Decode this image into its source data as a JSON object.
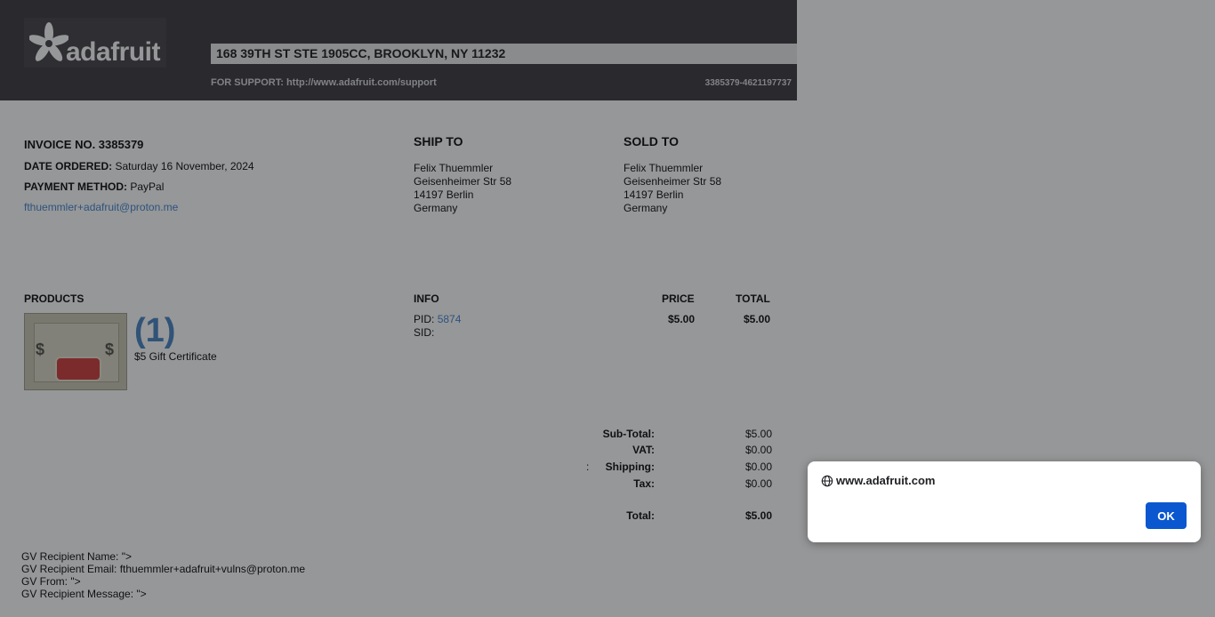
{
  "header": {
    "logo_text": "adafruit",
    "address": "168 39TH ST STE 1905CC, BROOKLYN, NY 11232",
    "support": "FOR SUPPORT: http://www.adafruit.com/support",
    "order_ref": "3385379-4621197737"
  },
  "invoice": {
    "title": "INVOICE NO. 3385379",
    "date_label": "DATE ORDERED:",
    "date_value": "Saturday 16 November, 2024",
    "payment_label": "PAYMENT METHOD:",
    "payment_value": "PayPal",
    "email": "fthuemmler+adafruit@proton.me"
  },
  "ship_to": {
    "title": "SHIP TO",
    "lines": [
      "Felix Thuemmler",
      "Geisenheimer Str 58",
      "14197 Berlin",
      "Germany"
    ]
  },
  "sold_to": {
    "title": "SOLD TO",
    "lines": [
      "Felix Thuemmler",
      "Geisenheimer Str 58",
      "14197 Berlin",
      "Germany"
    ]
  },
  "products": {
    "col_products": "PRODUCTS",
    "col_info": "INFO",
    "col_price": "PRICE",
    "col_total": "TOTAL",
    "items": [
      {
        "qty": "(1)",
        "name": "$5 Gift Certificate",
        "pid_label": "PID:",
        "pid_value": "5874",
        "sid_label": "SID:",
        "price": "$5.00",
        "total": "$5.00"
      }
    ]
  },
  "totals": {
    "subtotal_label": "Sub-Total:",
    "subtotal_value": "$5.00",
    "vat_label": "VAT:",
    "vat_value": "$0.00",
    "shipping_prefix": ":",
    "shipping_label": "Shipping:",
    "shipping_value": "$0.00",
    "tax_label": "Tax:",
    "tax_value": "$0.00",
    "total_label": "Total:",
    "total_value": "$5.00"
  },
  "gift_voucher": {
    "recipient_name": "GV Recipient Name: \">",
    "recipient_email": "GV Recipient Email: fthuemmler+adafruit+vulns@proton.me",
    "from": "GV From: \">",
    "message": "GV Recipient Message: \">"
  },
  "dialog": {
    "origin": "www.adafruit.com",
    "ok_label": "OK",
    "icon": "globe-icon"
  },
  "colors": {
    "header_bg": "#333036",
    "link": "#3a7fd0",
    "dialog_button": "#0b57d0"
  }
}
